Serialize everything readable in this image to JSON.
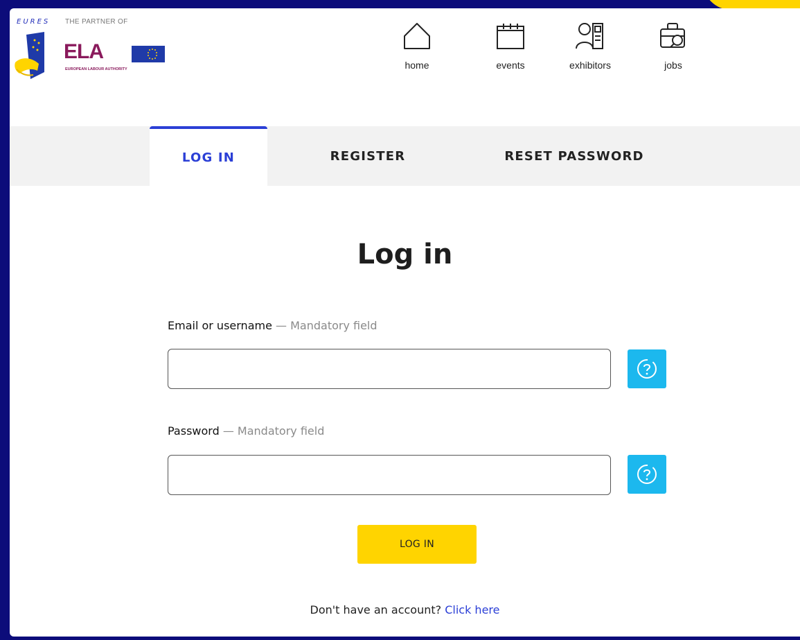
{
  "branding": {
    "eures": "EURES",
    "partner_of": "THE PARTNER OF",
    "ela": "ELA",
    "ela_full": "EUROPEAN LABOUR AUTHORITY"
  },
  "nav": {
    "items": [
      {
        "label": "home",
        "icon": "home-icon"
      },
      {
        "label": "events",
        "icon": "calendar-icon"
      },
      {
        "label": "exhibitors",
        "icon": "exhibitor-icon"
      },
      {
        "label": "jobs",
        "icon": "briefcase-search-icon"
      }
    ]
  },
  "tabs": [
    {
      "label": "LOG IN",
      "active": true
    },
    {
      "label": "REGISTER",
      "active": false
    },
    {
      "label": "RESET PASSWORD",
      "active": false
    }
  ],
  "form": {
    "title": "Log in",
    "email_label": "Email or username",
    "email_mandatory": "— Mandatory field",
    "email_value": "",
    "password_label": "Password",
    "password_mandatory": "— Mandatory field",
    "password_value": "",
    "submit_label": "LOG IN",
    "signup_prompt": "Don't have an account?",
    "signup_link": "Click here"
  },
  "colors": {
    "accent_blue": "#2b3fd6",
    "help_cyan": "#1cb8ee",
    "button_yellow": "#ffd400",
    "frame_navy": "#0c0c7a",
    "ela_purple": "#8a1a5c"
  }
}
